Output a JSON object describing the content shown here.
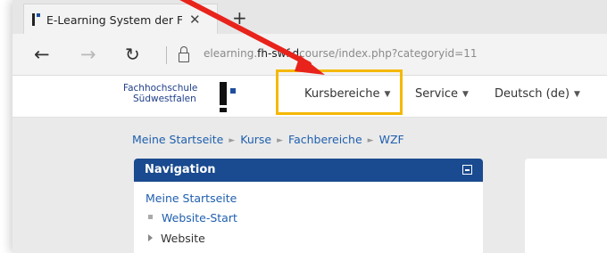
{
  "browser": {
    "tab_title": "E-Learning System der F",
    "close_glyph": "✕",
    "new_tab_glyph": "+",
    "back_glyph": "←",
    "forward_glyph": "→",
    "refresh_glyph": "↻",
    "url_prefix": "elearning.",
    "url_host": "fh-swf.d",
    "url_path": "course/index.php?categoryid=11"
  },
  "logo": {
    "line1": "Fachhochschule",
    "line2": "Südwestfalen"
  },
  "navbar": {
    "items": [
      {
        "label": "Kursbereiche"
      },
      {
        "label": "Service"
      },
      {
        "label": "Deutsch (de)"
      }
    ],
    "caret": "▼"
  },
  "breadcrumb": {
    "items": [
      "Meine Startseite",
      "Kurse",
      "Fachbereiche",
      "WZF"
    ],
    "separator": "►"
  },
  "navigation_block": {
    "title": "Navigation",
    "items": [
      "Meine Startseite",
      "Website-Start",
      "Website"
    ]
  },
  "annotation": {
    "arrow_color": "#e8231b",
    "highlight_color": "#f5b800"
  },
  "colors": {
    "link": "#1f5fae",
    "block_header": "#1a4a8f"
  },
  "icons": [
    "favicon-icon",
    "close-icon",
    "new-tab-icon",
    "back-icon",
    "forward-icon",
    "refresh-icon",
    "lock-icon",
    "caret-down-icon",
    "collapse-icon"
  ]
}
